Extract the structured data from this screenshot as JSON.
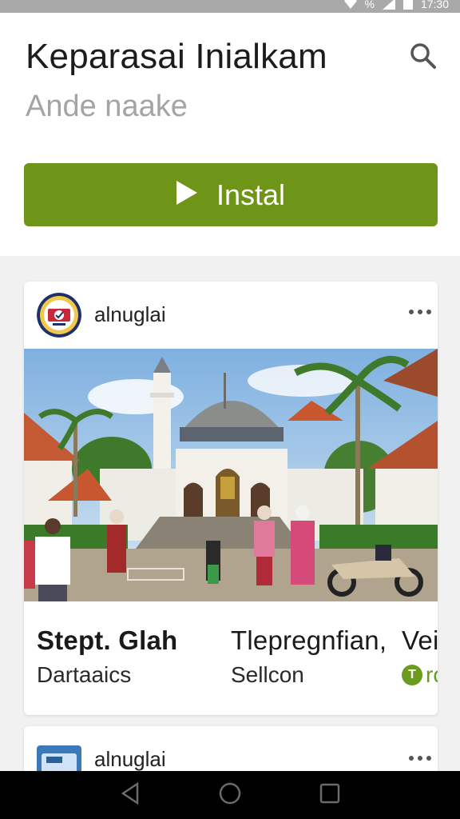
{
  "status_bar": {
    "signal_label": "%",
    "time": "17:30"
  },
  "app": {
    "title": "Keparasai Inialkam",
    "subtitle": "Ande naake",
    "install_label": "Instal"
  },
  "cards": [
    {
      "channel_name": "alnuglai",
      "tiles": [
        {
          "title": "Stept. Glah",
          "subtitle": "Dartaaics"
        },
        {
          "title": "Tlepregnfian,",
          "subtitle": "Sellcon"
        },
        {
          "title": "Vei",
          "subtitle": "ro",
          "badge": "T"
        }
      ]
    },
    {
      "channel_name": "alnuglai"
    }
  ],
  "colors": {
    "accent": "#6e9418",
    "badge_green": "#6a9b1f"
  },
  "icons": [
    "wifi-icon",
    "signal-icon",
    "battery-icon",
    "search-icon",
    "play-icon",
    "more-icon",
    "back-icon",
    "home-icon",
    "recents-icon"
  ]
}
